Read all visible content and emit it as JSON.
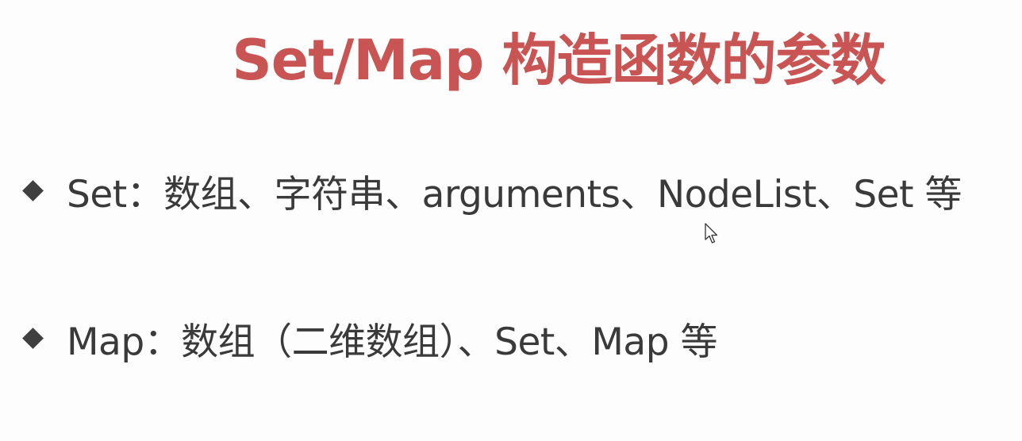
{
  "slide": {
    "title": "Set/Map 构造函数的参数",
    "bullets": [
      {
        "text": "Set：数组、字符串、arguments、NodeList、Set 等"
      },
      {
        "text": "Map：数组（二维数组）、Set、Map 等"
      }
    ]
  },
  "icons": {
    "bullet": "diamond-bullet-icon",
    "cursor": "mouse-pointer-icon"
  },
  "colors": {
    "title": "#c85453",
    "body_text": "#3a3a3a",
    "bullet": "#3f3f3f",
    "background": "#fdfdfd"
  }
}
